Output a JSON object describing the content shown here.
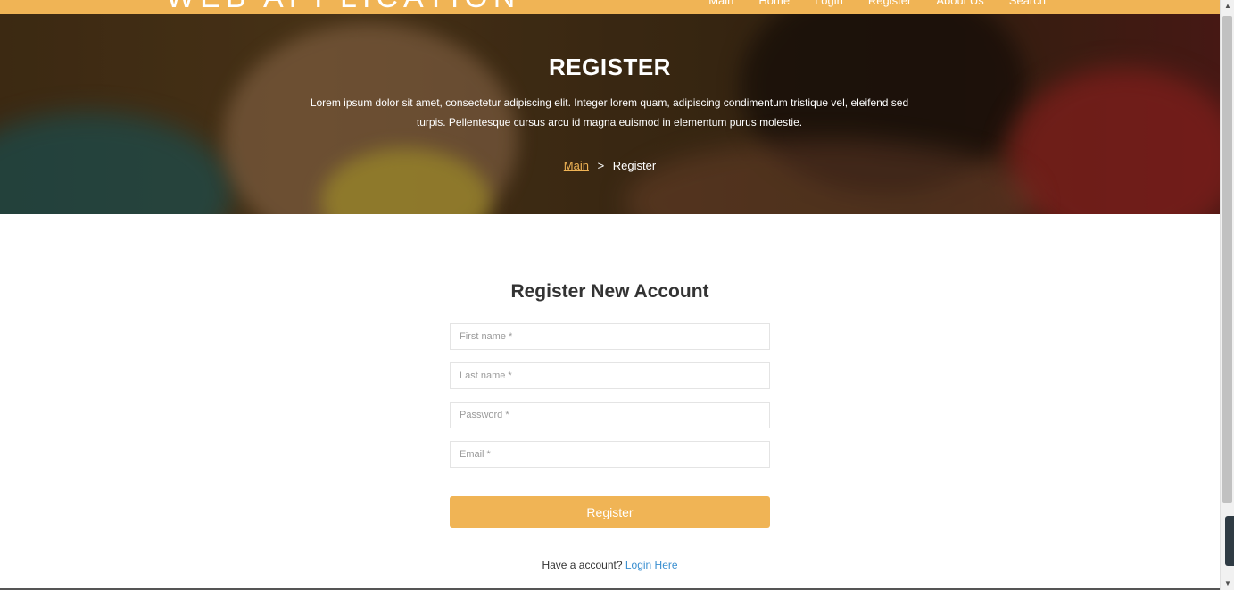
{
  "header": {
    "brand": "WEB APPLICATION",
    "nav": [
      {
        "label": "Main"
      },
      {
        "label": "Home"
      },
      {
        "label": "Login"
      },
      {
        "label": "Register"
      },
      {
        "label": "About Us"
      },
      {
        "label": "Search"
      }
    ]
  },
  "hero": {
    "title": "REGISTER",
    "text": "Lorem ipsum dolor sit amet, consectetur adipiscing elit. Integer lorem quam, adipiscing condimentum tristique vel, eleifend sed turpis. Pellentesque cursus arcu id magna euismod in elementum purus molestie.",
    "breadcrumb": {
      "link": "Main",
      "separator": ">",
      "current": "Register"
    }
  },
  "form": {
    "title": "Register New Account",
    "first_name_placeholder": "First name *",
    "last_name_placeholder": "Last name *",
    "password_placeholder": "Password *",
    "email_placeholder": "Email *",
    "submit_label": "Register",
    "have_account_text": "Have a account?",
    "login_link": "Login Here"
  },
  "colors": {
    "accent": "#f0b455",
    "link": "#3a8fd0"
  },
  "icons": {
    "scroll_up": "triangle-up-icon",
    "scroll_down": "triangle-down-icon"
  }
}
